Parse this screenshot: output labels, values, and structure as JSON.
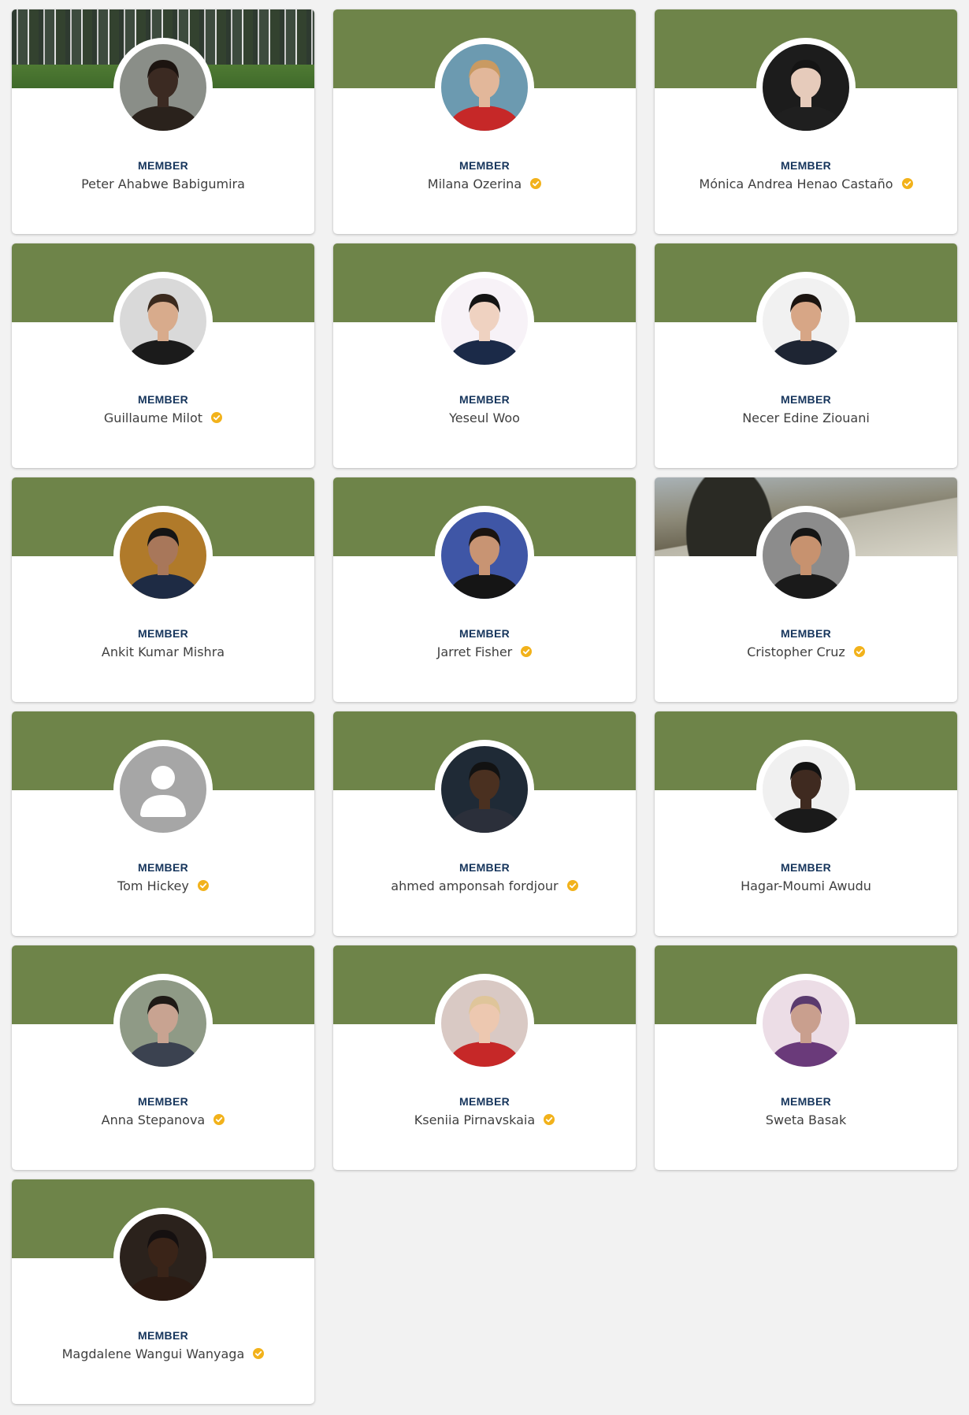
{
  "members": [
    {
      "role": "MEMBER",
      "name": "Peter Ahabwe Babigumira",
      "verified": false,
      "banner": "photo-flags",
      "avatar": {
        "bg": "#8a8e88",
        "skin": "#3b2a22",
        "shirt": "#2a221c",
        "hair": "#1c1410"
      }
    },
    {
      "role": "MEMBER",
      "name": "Milana Ozerina",
      "verified": true,
      "banner": "green",
      "avatar": {
        "bg": "#6c9ab0",
        "skin": "#e2b79a",
        "shirt": "#c62828",
        "hair": "#c99a62"
      }
    },
    {
      "role": "MEMBER",
      "name": "Mónica Andrea Henao Castaño",
      "verified": true,
      "banner": "green",
      "avatar": {
        "bg": "#1c1c1c",
        "skin": "#e6cbbb",
        "shirt": "#1f1f1f",
        "hair": "#141414"
      }
    },
    {
      "role": "MEMBER",
      "name": "Guillaume Milot",
      "verified": true,
      "banner": "green",
      "avatar": {
        "bg": "#d9d9d9",
        "skin": "#d8ab8c",
        "shirt": "#1b1b1b",
        "hair": "#3b2a1e"
      }
    },
    {
      "role": "MEMBER",
      "name": "Yeseul Woo",
      "verified": false,
      "banner": "green",
      "avatar": {
        "bg": "#f7f2f7",
        "skin": "#efd2c1",
        "shirt": "#1b2a48",
        "hair": "#141414"
      }
    },
    {
      "role": "MEMBER",
      "name": "Necer Edine Ziouani",
      "verified": false,
      "banner": "green",
      "avatar": {
        "bg": "#f1f1f1",
        "skin": "#d7a686",
        "shirt": "#1e2533",
        "hair": "#1b1410"
      }
    },
    {
      "role": "MEMBER",
      "name": "Ankit Kumar Mishra",
      "verified": false,
      "banner": "green",
      "avatar": {
        "bg": "#b07a2a",
        "skin": "#a8775a",
        "shirt": "#1e2b44",
        "hair": "#151515"
      }
    },
    {
      "role": "MEMBER",
      "name": "Jarret Fisher",
      "verified": true,
      "banner": "green",
      "avatar": {
        "bg": "#3f56a6",
        "skin": "#c89473",
        "shirt": "#151515",
        "hair": "#1b1410"
      }
    },
    {
      "role": "MEMBER",
      "name": "Cristopher Cruz",
      "verified": true,
      "banner": "photo-mountain",
      "avatar": {
        "bg": "#8c8c8c",
        "skin": "#c7926f",
        "shirt": "#1a1a1a",
        "hair": "#151515"
      }
    },
    {
      "role": "MEMBER",
      "name": "Tom Hickey",
      "verified": true,
      "banner": "green",
      "avatar": {
        "bg": "#a6a6a6",
        "skin": "#ffffff",
        "shirt": "#ffffff",
        "hair": "#ffffff",
        "placeholder": true
      }
    },
    {
      "role": "MEMBER",
      "name": "ahmed amponsah fordjour",
      "verified": true,
      "banner": "green",
      "avatar": {
        "bg": "#1f2a36",
        "skin": "#4a3020",
        "shirt": "#2b2f3a",
        "hair": "#121212"
      }
    },
    {
      "role": "MEMBER",
      "name": "Hagar-Moumi Awudu",
      "verified": false,
      "banner": "green",
      "avatar": {
        "bg": "#f0f0f0",
        "skin": "#3f2a20",
        "shirt": "#1a1a1a",
        "hair": "#121212"
      }
    },
    {
      "role": "MEMBER",
      "name": "Anna Stepanova",
      "verified": true,
      "banner": "green",
      "avatar": {
        "bg": "#8f9a86",
        "skin": "#c8a391",
        "shirt": "#3b4250",
        "hair": "#1f1a16"
      }
    },
    {
      "role": "MEMBER",
      "name": "Kseniia Pirnavskaia",
      "verified": true,
      "banner": "green",
      "avatar": {
        "bg": "#d9c9c4",
        "skin": "#edc8b0",
        "shirt": "#c62828",
        "hair": "#dfc59a"
      }
    },
    {
      "role": "MEMBER",
      "name": "Sweta Basak",
      "verified": false,
      "banner": "green",
      "avatar": {
        "bg": "#ecdde6",
        "skin": "#c99f8e",
        "shirt": "#6a3a7a",
        "hair": "#5a3a6e"
      }
    },
    {
      "role": "MEMBER",
      "name": "Magdalene Wangui Wanyaga",
      "verified": true,
      "banner": "green",
      "avatar": {
        "bg": "#2b221c",
        "skin": "#3a2418",
        "shirt": "#2b1a12",
        "hair": "#151010"
      }
    }
  ],
  "colors": {
    "banner_green": "#6e8449",
    "role_text": "#16355c",
    "name_text": "#3f3f3f",
    "verified_badge": "#f2b21b"
  },
  "icons": {
    "verified": "verified-check-icon",
    "placeholder_avatar": "person-placeholder-icon"
  }
}
